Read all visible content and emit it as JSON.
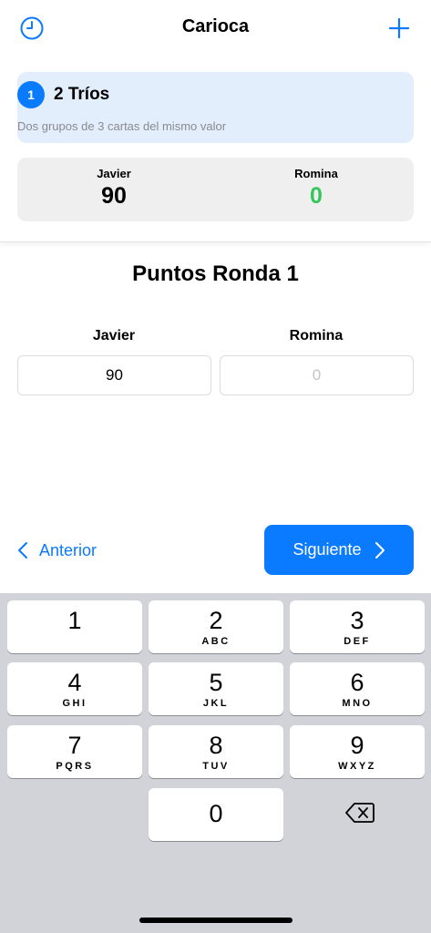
{
  "nav": {
    "title": "Carioca"
  },
  "round": {
    "number": "1",
    "title": "2 Tríos",
    "description": "Dos grupos de 3 cartas del mismo valor"
  },
  "totals": [
    {
      "name": "Javier",
      "score": "90"
    },
    {
      "name": "Romina",
      "score": "0"
    }
  ],
  "entry": {
    "title": "Puntos Ronda 1",
    "players": [
      {
        "name": "Javier",
        "value": "90",
        "placeholder": "0"
      },
      {
        "name": "Romina",
        "value": "",
        "placeholder": "0"
      }
    ]
  },
  "actions": {
    "previous_label": "Anterior",
    "next_label": "Siguiente"
  },
  "keypad": {
    "keys": [
      {
        "num": "1",
        "letters": ""
      },
      {
        "num": "2",
        "letters": "ABC"
      },
      {
        "num": "3",
        "letters": "DEF"
      },
      {
        "num": "4",
        "letters": "GHI"
      },
      {
        "num": "5",
        "letters": "JKL"
      },
      {
        "num": "6",
        "letters": "MNO"
      },
      {
        "num": "7",
        "letters": "PQRS"
      },
      {
        "num": "8",
        "letters": "TUV"
      },
      {
        "num": "9",
        "letters": "WXYZ"
      },
      {
        "num": "0",
        "letters": ""
      }
    ]
  },
  "colors": {
    "accent": "#0a7aff",
    "round_card_bg": "#e3eefc",
    "score_card_bg": "#efeff0",
    "zero_score": "#34c759",
    "keyboard_bg": "#d2d3d9"
  },
  "icons": {
    "history": "clock-icon",
    "add": "plus-icon",
    "previous": "chevron-left-icon",
    "next": "chevron-right-icon",
    "delete": "backspace-icon"
  }
}
